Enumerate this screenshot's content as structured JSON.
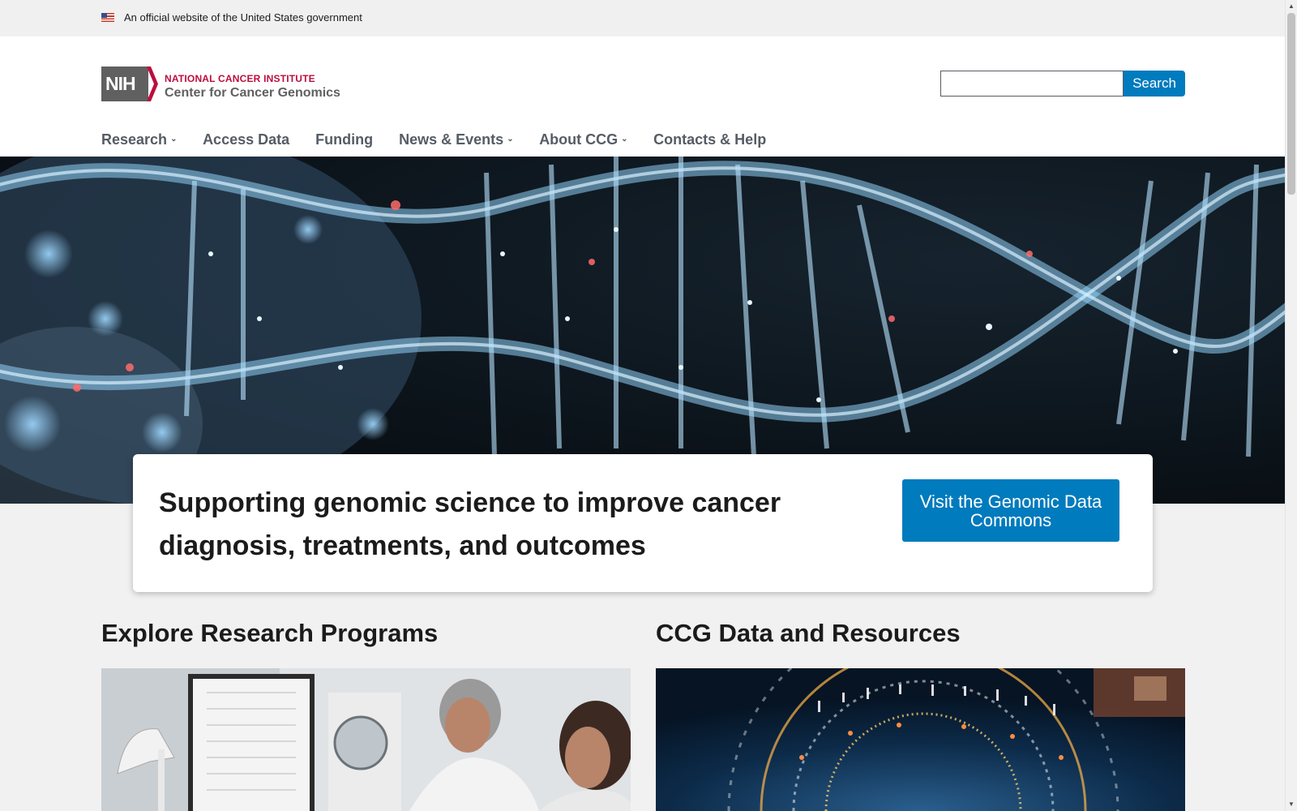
{
  "gov_banner": {
    "text": "An official website of the United States government",
    "flag_icon": "us-flag-icon"
  },
  "header": {
    "logo": {
      "mark": "NIH",
      "institute": "NATIONAL CANCER INSTITUTE",
      "center": "Center for Cancer Genomics"
    },
    "search": {
      "value": "",
      "button_label": "Search"
    }
  },
  "nav": {
    "items": [
      {
        "label": "Research",
        "has_dropdown": true
      },
      {
        "label": "Access Data",
        "has_dropdown": false
      },
      {
        "label": "Funding",
        "has_dropdown": false
      },
      {
        "label": "News & Events",
        "has_dropdown": true
      },
      {
        "label": "About CCG",
        "has_dropdown": true
      },
      {
        "label": "Contacts & Help",
        "has_dropdown": false
      }
    ]
  },
  "hero": {
    "heading": "Supporting genomic science to improve cancer diagnosis, treatments, and outcomes",
    "cta_label": "Visit the Genomic Data Commons"
  },
  "sections": {
    "left_title": "Explore Research Programs",
    "right_title": "CCG Data and Resources"
  },
  "colors": {
    "primary": "#007bbd",
    "nci_red": "#bb0e3d",
    "nav_text": "#565c65",
    "page_bg": "#f1f1f1"
  }
}
